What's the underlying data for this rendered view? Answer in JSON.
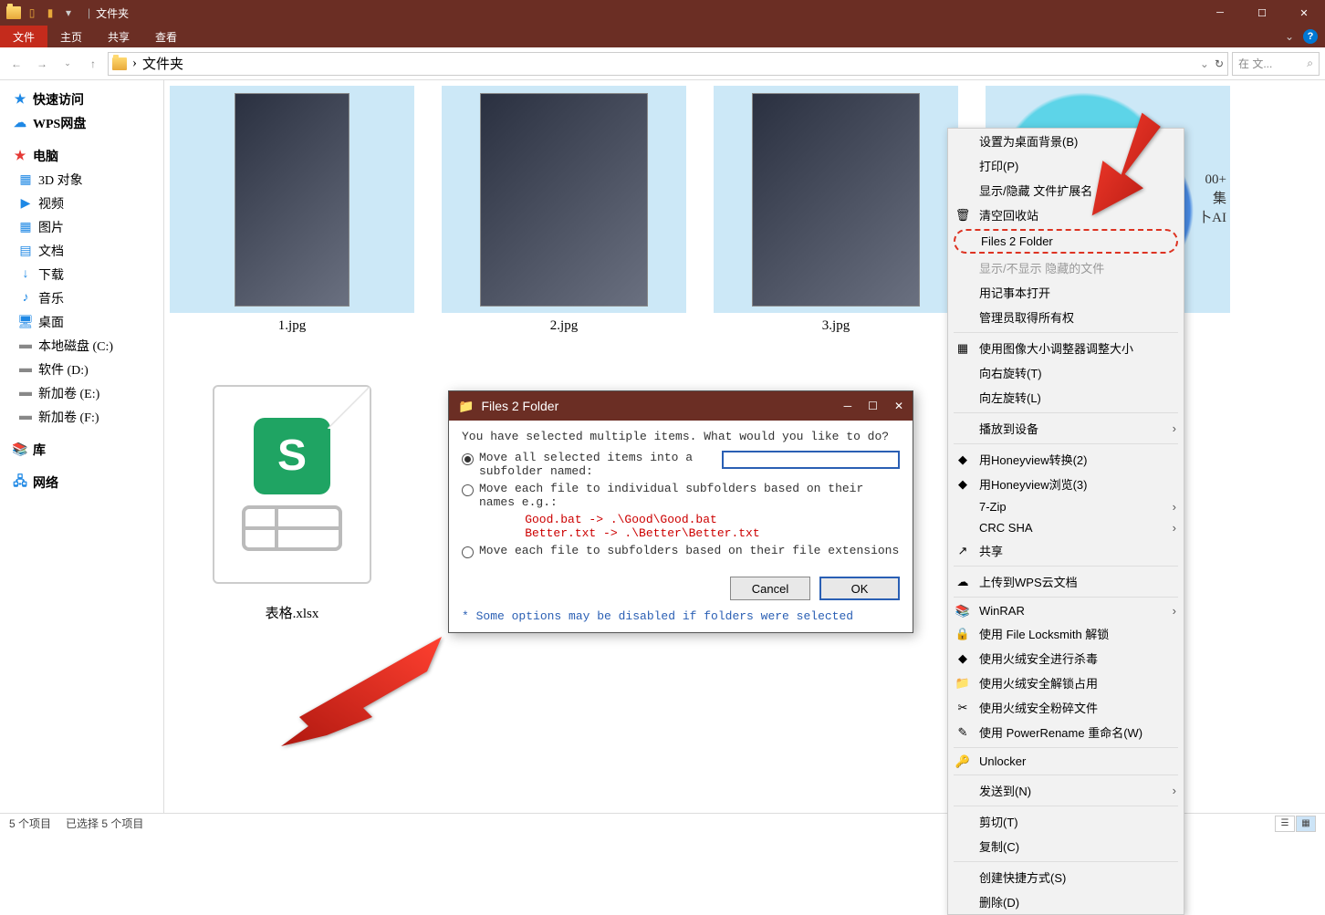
{
  "window": {
    "title": "文件夹"
  },
  "ribbon": {
    "tabs": [
      "文件",
      "主页",
      "共享",
      "查看"
    ]
  },
  "nav": {
    "path_prefix": "›",
    "path": "文件夹",
    "search_placeholder": "在 文...",
    "search_icon": "⌕"
  },
  "sidebar": [
    {
      "label": "快速访问",
      "root": true,
      "icon": "★",
      "color": "#1e88e5"
    },
    {
      "label": "WPS网盘",
      "root": true,
      "icon": "☁",
      "color": "#1e88e5"
    },
    {
      "label": "电脑",
      "root": true,
      "icon": "★",
      "color": "#e53935"
    },
    {
      "label": "3D 对象",
      "icon": "▦",
      "color": "#1e88e5"
    },
    {
      "label": "视频",
      "icon": "▶",
      "color": "#1e88e5"
    },
    {
      "label": "图片",
      "icon": "▦",
      "color": "#1e88e5"
    },
    {
      "label": "文档",
      "icon": "▤",
      "color": "#1e88e5"
    },
    {
      "label": "下载",
      "icon": "↓",
      "color": "#1e88e5"
    },
    {
      "label": "音乐",
      "icon": "♪",
      "color": "#1e88e5"
    },
    {
      "label": "桌面",
      "icon": "🖥",
      "color": "#1e88e5"
    },
    {
      "label": "本地磁盘 (C:)",
      "icon": "▬",
      "color": "#888"
    },
    {
      "label": "软件 (D:)",
      "icon": "▬",
      "color": "#888"
    },
    {
      "label": "新加卷 (E:)",
      "icon": "▬",
      "color": "#888"
    },
    {
      "label": "新加卷 (F:)",
      "icon": "▬",
      "color": "#888"
    },
    {
      "label": "库",
      "root": true,
      "icon": "📚",
      "color": "#d89030"
    },
    {
      "label": "网络",
      "root": true,
      "icon": "🖧",
      "color": "#1e88e5"
    }
  ],
  "files": [
    {
      "name": "1.jpg",
      "type": "img"
    },
    {
      "name": "2.jpg",
      "type": "img-wide"
    },
    {
      "name": "3.jpg",
      "type": "img-wide"
    },
    {
      "name": "",
      "type": "ai",
      "ai_text": "00+\n集\n卜AI"
    },
    {
      "name": "表格.xlsx",
      "type": "xlsx"
    }
  ],
  "status": {
    "count": "5 个项目",
    "selection": "已选择 5 个项目"
  },
  "context_menu": [
    {
      "label": "设置为桌面背景(B)",
      "type": "item"
    },
    {
      "label": "打印(P)",
      "type": "item"
    },
    {
      "label": "显示/隐藏 文件扩展名",
      "type": "item"
    },
    {
      "label": "清空回收站",
      "type": "item",
      "icon": "🗑"
    },
    {
      "label": "Files 2 Folder",
      "type": "highlighted"
    },
    {
      "label": "显示/不显示 隐藏的文件",
      "type": "faded"
    },
    {
      "label": "用记事本打开",
      "type": "item"
    },
    {
      "label": "管理员取得所有权",
      "type": "item"
    },
    {
      "type": "sep"
    },
    {
      "label": "使用图像大小调整器调整大小",
      "type": "item",
      "icon": "▦"
    },
    {
      "label": "向右旋转(T)",
      "type": "item"
    },
    {
      "label": "向左旋转(L)",
      "type": "item"
    },
    {
      "type": "sep"
    },
    {
      "label": "播放到设备",
      "type": "submenu"
    },
    {
      "type": "sep"
    },
    {
      "label": "用Honeyview转换(2)",
      "type": "item",
      "icon": "◆"
    },
    {
      "label": "用Honeyview浏览(3)",
      "type": "item",
      "icon": "◆"
    },
    {
      "label": "7-Zip",
      "type": "submenu"
    },
    {
      "label": "CRC SHA",
      "type": "submenu"
    },
    {
      "label": "共享",
      "type": "item",
      "icon": "↗"
    },
    {
      "type": "sep"
    },
    {
      "label": "上传到WPS云文档",
      "type": "item",
      "icon": "☁"
    },
    {
      "type": "sep"
    },
    {
      "label": "WinRAR",
      "type": "submenu",
      "icon": "📚"
    },
    {
      "label": "使用 File Locksmith 解锁",
      "type": "item",
      "icon": "🔒"
    },
    {
      "label": "使用火绒安全进行杀毒",
      "type": "item",
      "icon": "◆"
    },
    {
      "label": "使用火绒安全解锁占用",
      "type": "item",
      "icon": "📁"
    },
    {
      "label": "使用火绒安全粉碎文件",
      "type": "item",
      "icon": "✂"
    },
    {
      "label": "使用 PowerRename 重命名(W)",
      "type": "item",
      "icon": "✎"
    },
    {
      "type": "sep"
    },
    {
      "label": "Unlocker",
      "type": "item",
      "icon": "🔑"
    },
    {
      "type": "sep"
    },
    {
      "label": "发送到(N)",
      "type": "submenu"
    },
    {
      "type": "sep"
    },
    {
      "label": "剪切(T)",
      "type": "item"
    },
    {
      "label": "复制(C)",
      "type": "item"
    },
    {
      "type": "sep"
    },
    {
      "label": "创建快捷方式(S)",
      "type": "item"
    },
    {
      "label": "删除(D)",
      "type": "item"
    }
  ],
  "dialog": {
    "title": "Files 2 Folder",
    "prompt": "You have selected multiple items.  What would you like to do?",
    "option1": "Move all selected items into a subfolder named:",
    "option2": "Move each file to individual subfolders based on their names e.g.:",
    "example": "    Good.bat -> .\\Good\\Good.bat\n    Better.txt -> .\\Better\\Better.txt",
    "option3": "Move each file to subfolders based on their file extensions",
    "cancel": "Cancel",
    "ok": "OK",
    "footer": "* Some options may be disabled if folders were selected"
  }
}
